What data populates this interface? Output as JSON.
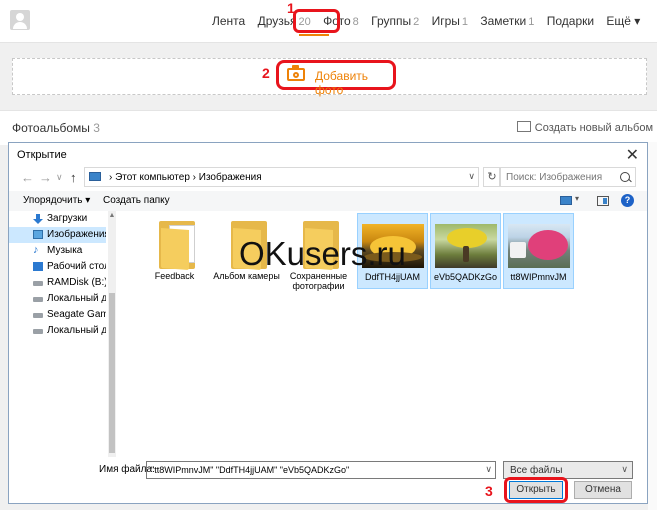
{
  "topnav": {
    "items": [
      {
        "label": "Лента",
        "count": ""
      },
      {
        "label": "Друзья",
        "count": "20"
      },
      {
        "label": "Фото",
        "count": "8"
      },
      {
        "label": "Группы",
        "count": "2"
      },
      {
        "label": "Игры",
        "count": "1"
      },
      {
        "label": "Заметки",
        "count": "1"
      },
      {
        "label": "Подарки",
        "count": ""
      },
      {
        "label": "Ещё ▾",
        "count": ""
      }
    ]
  },
  "annotations": {
    "n1": "1",
    "n2": "2",
    "n3": "3"
  },
  "add_photo": {
    "label": "Добавить фото"
  },
  "albums": {
    "title": "Фотоальбомы",
    "count": "3",
    "create_label": "Создать новый альбом"
  },
  "dialog": {
    "title": "Открытие",
    "breadcrumb": "›  Этот компьютер  ›  Изображения",
    "search_placeholder": "Поиск: Изображения",
    "toolbar": {
      "organize": "Упорядочить ▾",
      "new_folder": "Создать папку",
      "help": "?"
    },
    "sidebar": [
      {
        "label": "Загрузки",
        "icon": "download-icon"
      },
      {
        "label": "Изображения",
        "icon": "images-icon"
      },
      {
        "label": "Музыка",
        "icon": "music-icon"
      },
      {
        "label": "Рабочий стол",
        "icon": "desktop-icon"
      },
      {
        "label": "RAMDisk (B:)",
        "icon": "drive-icon"
      },
      {
        "label": "Локальный дис",
        "icon": "drive-icon"
      },
      {
        "label": "Seagate Game D",
        "icon": "drive-icon"
      },
      {
        "label": "Локальный дис",
        "icon": "drive-icon"
      }
    ],
    "files": [
      {
        "name": "Feedback",
        "kind": "folder"
      },
      {
        "name": "Альбом камеры",
        "kind": "folder"
      },
      {
        "name": "Сохраненные фотографии",
        "kind": "folder"
      },
      {
        "name": "DdfTH4jjUAM",
        "kind": "image"
      },
      {
        "name": "eVb5QADKzGo",
        "kind": "image"
      },
      {
        "name": "tt8WIPmnvJM",
        "kind": "image"
      }
    ],
    "filename_label": "Имя файла:",
    "filename_value": "\"tt8WIPmnvJM\" \"DdfTH4jjUAM\" \"eVb5QADKzGo\"",
    "filetype_value": "Все файлы",
    "open_label": "Открыть",
    "cancel_label": "Отмена"
  },
  "watermark": "OKusers.ru",
  "colors": {
    "accent": "#ee8208",
    "highlight": "#e8141c",
    "selection": "#cce8ff"
  }
}
